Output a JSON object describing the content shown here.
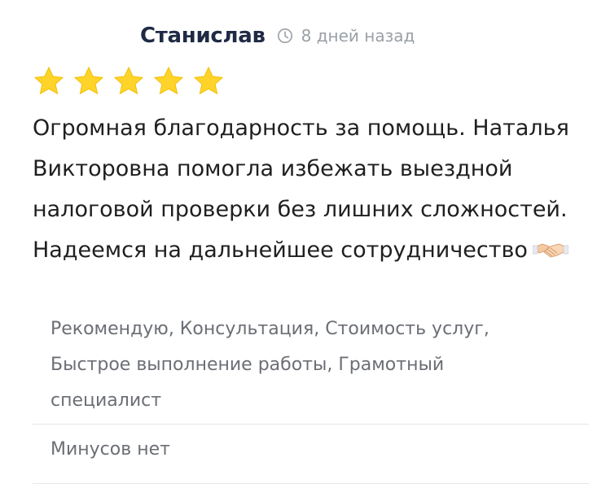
{
  "review": {
    "author": "Станислав",
    "time": "8 дней назад",
    "rating": 5,
    "rating_max": 5,
    "text_lines": [
      "Огромная благодарность за помощь. Наталья",
      "Викторовна помогла избежать выездной",
      "налоговой проверки без лишних сложностей.",
      "Надеемся на дальнейшее сотрудничество"
    ],
    "text_emoji": "handshake-icon",
    "pros_lines": [
      "Рекомендую, Консультация, Стоимость услуг,",
      "Быстрое выполнение работы, Грамотный",
      "специалист"
    ],
    "cons": "Минусов нет"
  },
  "colors": {
    "star": "#FFD42A",
    "author": "#1f2a44",
    "muted": "#9aa0a6",
    "tags": "#6b6f75",
    "divider": "#e6e6e6"
  }
}
